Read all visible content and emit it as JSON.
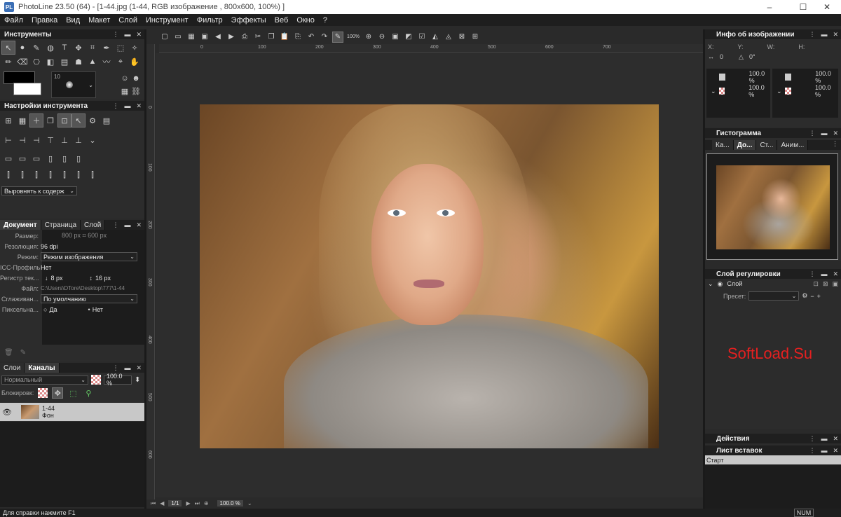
{
  "window": {
    "title": "PhotoLine 23.50 (64) - [1-44.jpg (1-44, RGB изображение , 800x600, 100%) ]",
    "app_icon": "PL",
    "minimize": "–",
    "maximize": "☐",
    "close": "✕"
  },
  "menu": [
    "Файл",
    "Правка",
    "Вид",
    "Макет",
    "Слой",
    "Инструмент",
    "Фильтр",
    "Эффекты",
    "Веб",
    "Окно",
    "?"
  ],
  "tools_panel": {
    "title": "Инструменты",
    "brush_size": "10"
  },
  "tool_settings": {
    "title": "Настройки инструмента",
    "align_dropdown": "Выровнять к содерж"
  },
  "doc_panel": {
    "tabs": [
      "Документ",
      "Страница",
      "Слой"
    ],
    "rows": [
      {
        "label": "Размер:",
        "value": "800 px  ⌗  600 px"
      },
      {
        "label": "Резолюция:",
        "value": "96 dpi"
      },
      {
        "label": "Режим:",
        "value": "Режим изображения"
      },
      {
        "label": "ICC-Профиль:",
        "value": "Нет"
      },
      {
        "label": "Регистр тек...",
        "value1": "8 px",
        "value2": "16 px"
      },
      {
        "label": "Файл:",
        "value": "C:\\Users\\DTore\\Desktop\\777\\1-44"
      },
      {
        "label": "Сглаживан...",
        "value": "По умолчанию"
      },
      {
        "label": "Пиксельна...",
        "opt1": "Да",
        "opt2": "Нет"
      }
    ]
  },
  "layers_panel": {
    "tabs": [
      "Слои",
      "Каналы"
    ],
    "blend_mode": "Нормальный",
    "opacity": "100.0 %",
    "lock_label": "Блокировк:",
    "layer": {
      "name": "1-44",
      "sub": "Фон"
    }
  },
  "toolbar2": {
    "zoom": "100%"
  },
  "ruler_h": [
    "0",
    "100",
    "200",
    "300",
    "400",
    "500",
    "600",
    "700"
  ],
  "ruler_v": [
    "0",
    "100",
    "200",
    "300",
    "400",
    "500",
    "600"
  ],
  "info_panel": {
    "title": "Инфо об изображении",
    "x": "X:",
    "y": "Y:",
    "w": "W:",
    "h": "H:",
    "angle1": "0",
    "angle2": "0°",
    "pct": [
      "100.0 %",
      "100.0 %",
      "100.0 %",
      "100.0 %"
    ]
  },
  "histogram_panel": {
    "title": "Гистограмма",
    "tabs": [
      "Ка...",
      "До...",
      "Ст...",
      "Аним..."
    ]
  },
  "adjust_panel": {
    "title": "Слой регулировки",
    "layer": "Слой",
    "preset_label": "Пресет:"
  },
  "actions_panel": {
    "title": "Действия"
  },
  "clips_panel": {
    "title": "Лист вставок",
    "item": "Старт"
  },
  "watermark": "SoftLoad.Su",
  "nav": {
    "page": "1/1",
    "zoom": "100.0 %"
  },
  "status": {
    "text": "Для справки нажмите F1",
    "num": "NUM"
  }
}
